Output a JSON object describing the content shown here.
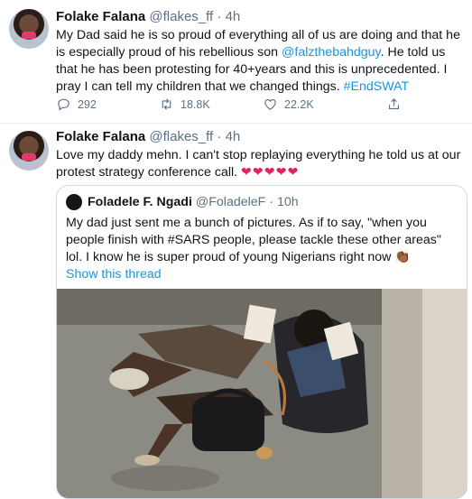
{
  "tweets": [
    {
      "name": "Folake Falana",
      "handle": "@flakes_ff",
      "dot": "·",
      "time": "4h",
      "text_before": "My Dad said he is so proud of everything all of us are doing and that he is especially proud of his rebellious son ",
      "mention": "@falzthebahdguy",
      "text_after": ". He told us that he has been protesting for 40+years and this is unprecedented. I pray I can tell my children that we changed things. ",
      "hashtag": "#EndSWAT",
      "replies": "292",
      "retweets": "18.8K",
      "likes": "22.2K"
    },
    {
      "name": "Folake Falana",
      "handle": "@flakes_ff",
      "dot": "·",
      "time": "4h",
      "text": "Love my daddy mehn. I can't stop replaying everything he told us at our protest strategy conference call. ",
      "hearts": "❤❤❤❤❤",
      "quote": {
        "name": "Foladele F. Ngadi",
        "handle": "@FoladeleF",
        "dot": "·",
        "time": "10h",
        "text": "My dad just sent me a bunch of pictures. As if to say, \"when you people finish with #SARS people, please tackle these other areas\" lol. I know he is super proud of young Nigerians right now 👏🏾",
        "show_thread": "Show this thread"
      }
    }
  ],
  "icons": [
    "reply-icon",
    "retweet-icon",
    "like-icon",
    "share-icon"
  ],
  "colors": {
    "link": "#1b95e0",
    "muted": "#5b7083",
    "heart": "#e0245e"
  }
}
